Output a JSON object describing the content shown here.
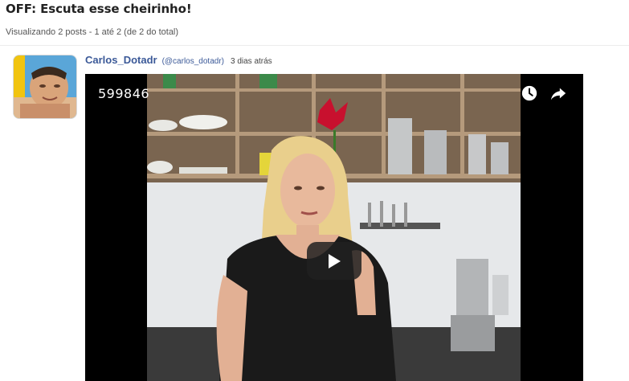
{
  "topic": {
    "title": "OFF: Escuta esse cheirinho!",
    "count_text": "Visualizando 2 posts - 1 até 2 (de 2 do total)"
  },
  "post": {
    "author_name": "Carlos_Dotadr",
    "author_handle": "(@carlos_dotadr)",
    "time": "3 dias atrás",
    "avatar": "user-avatar-photo"
  },
  "video": {
    "title": "599846",
    "icons": {
      "watch_later": "clock-icon",
      "share": "share-icon",
      "play": "play-icon"
    },
    "colors": {
      "background": "#000000",
      "play_button": "#212121"
    }
  },
  "colors": {
    "link": "#3b5998",
    "title": "#222222",
    "meta": "#555555"
  }
}
